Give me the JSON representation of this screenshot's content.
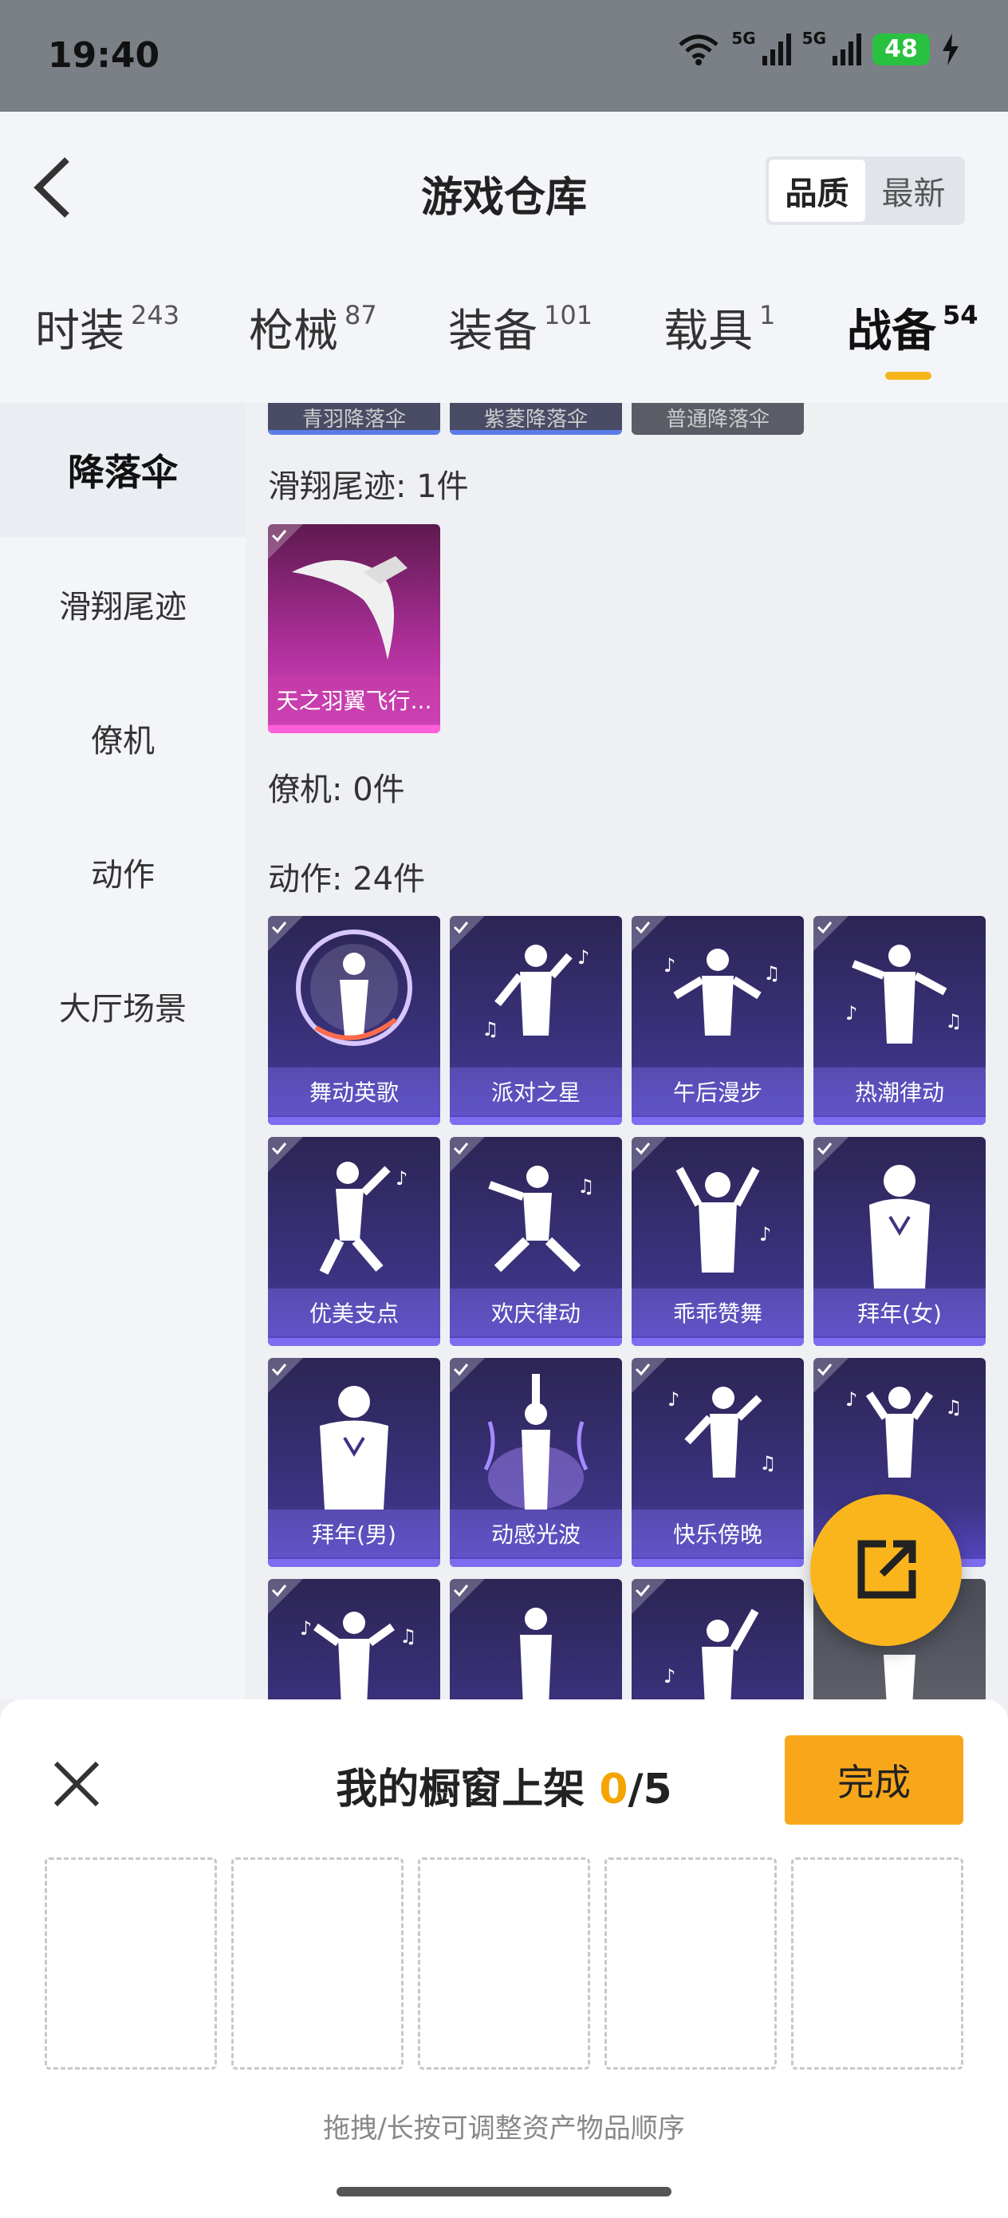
{
  "status": {
    "time": "19:40",
    "battery": "48",
    "network": "5G"
  },
  "header": {
    "title": "游戏仓库",
    "sort_options": [
      "品质",
      "最新"
    ]
  },
  "tabs": [
    {
      "label": "时装",
      "count": "243"
    },
    {
      "label": "枪械",
      "count": "87"
    },
    {
      "label": "装备",
      "count": "101"
    },
    {
      "label": "载具",
      "count": "1"
    },
    {
      "label": "战备",
      "count": "54"
    }
  ],
  "sidebar": {
    "items": [
      "降落伞",
      "滑翔尾迹",
      "僚机",
      "动作",
      "大厅场景"
    ]
  },
  "sections": {
    "parachute_strip": [
      "青羽降落伞",
      "紫菱降落伞",
      "普通降落伞"
    ],
    "trail": {
      "title": "滑翔尾迹: 1件",
      "items": [
        "天之羽翼飞行..."
      ]
    },
    "wingman": {
      "title": "僚机: 0件"
    },
    "emotes": {
      "title": "动作: 24件",
      "items": [
        "舞动英歌",
        "派对之星",
        "午后漫步",
        "热潮律动",
        "优美支点",
        "欢庆律动",
        "乖乖赞舞",
        "拜年(女)",
        "拜年(男)",
        "动感光波",
        "快乐傍晚"
      ]
    }
  },
  "sheet": {
    "title_prefix": "我的橱窗上架 ",
    "count": "0",
    "total": "/5",
    "done_label": "完成",
    "hint": "拖拽/长按可调整资产物品顺序"
  },
  "colors": {
    "accent": "#f7b51c",
    "emote_card": "#3c3483",
    "trail_card": "#b0309c"
  }
}
